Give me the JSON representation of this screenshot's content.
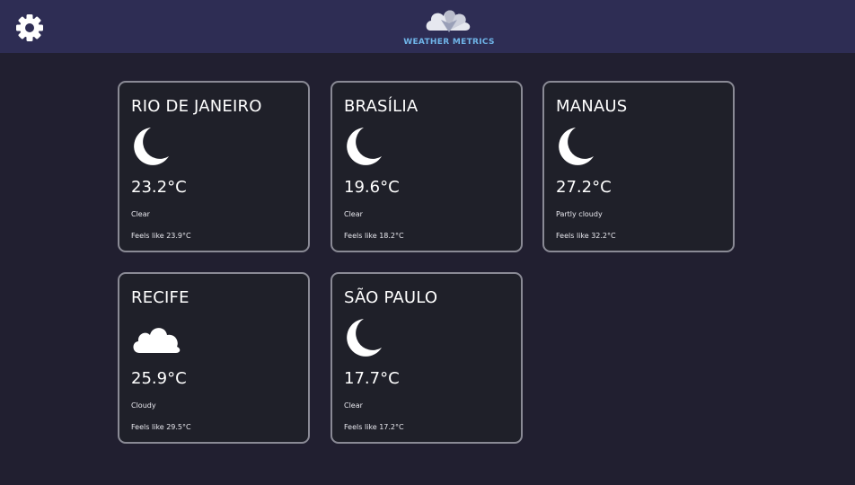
{
  "header": {
    "settings_icon": "gear-icon",
    "logo_icon": "cloud-logo-icon",
    "app_name": "WEATHER METRICS",
    "logo_color": "#6fb4e8",
    "background": "#2e2d54"
  },
  "cards": [
    {
      "city": "RIO DE JANEIRO",
      "icon": "moon-icon",
      "temp": "23.2°C",
      "condition": "Clear",
      "feels_like": "Feels like 23.9°C"
    },
    {
      "city": "BRASÍLIA",
      "icon": "moon-icon",
      "temp": "19.6°C",
      "condition": "Clear",
      "feels_like": "Feels like 18.2°C"
    },
    {
      "city": "MANAUS",
      "icon": "moon-icon",
      "temp": "27.2°C",
      "condition": "Partly cloudy",
      "feels_like": "Feels like 32.2°C"
    },
    {
      "city": "RECIFE",
      "icon": "cloud-icon",
      "temp": "25.9°C",
      "condition": "Cloudy",
      "feels_like": "Feels like 29.5°C"
    },
    {
      "city": "SÃO PAULO",
      "icon": "moon-icon",
      "temp": "17.7°C",
      "condition": "Clear",
      "feels_like": "Feels like 17.2°C"
    }
  ]
}
